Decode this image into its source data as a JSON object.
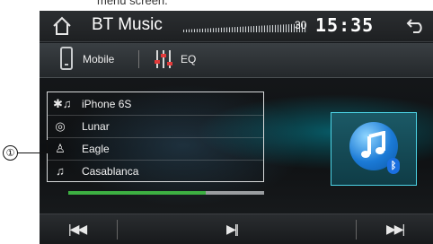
{
  "caption_fragment": "menu screen.",
  "header": {
    "title": "BT Music",
    "day": "30",
    "clock": "15:35"
  },
  "source_bar": {
    "mobile_label": "Mobile",
    "eq_label": "EQ"
  },
  "track_info": [
    {
      "icon": "bluetooth-music-icon",
      "text": "iPhone 6S"
    },
    {
      "icon": "album-disc-icon",
      "text": "Lunar"
    },
    {
      "icon": "artist-icon",
      "text": "Eagle"
    },
    {
      "icon": "music-note-icon",
      "text": "Casablanca"
    }
  ],
  "progress": 0.7,
  "controls": {
    "prev": "|◀◀",
    "play_pause": "▶||",
    "next": "▶▶|"
  },
  "callout": "①",
  "colors": {
    "progress_fill": "#3db042",
    "art_border": "#4dd4e6",
    "bluetooth_badge": "#1a6fe0"
  }
}
